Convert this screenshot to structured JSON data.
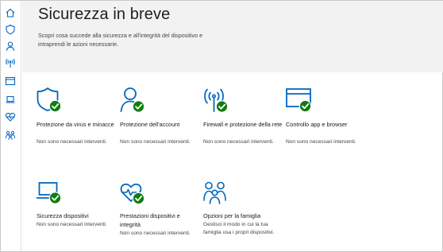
{
  "header": {
    "title": "Sicurezza in breve",
    "description": "Scopri cosa succede alla sicurezza e all'integrità del dispositivo e intraprendi le azioni necessarie."
  },
  "sidebar": {
    "items": [
      {
        "icon": "home-icon"
      },
      {
        "icon": "shield-icon"
      },
      {
        "icon": "person-icon"
      },
      {
        "icon": "wireless-icon"
      },
      {
        "icon": "browser-window-icon"
      },
      {
        "icon": "laptop-icon"
      },
      {
        "icon": "heart-icon"
      },
      {
        "icon": "family-icon"
      }
    ]
  },
  "colors": {
    "accent": "#0067c0",
    "status_ok": "#107c10",
    "header_bg": "#f2f2f2"
  },
  "tiles": [
    {
      "icon": "shield-icon",
      "title": "Protezione da virus e minacce",
      "status": "Non sono necessari interventi."
    },
    {
      "icon": "person-icon",
      "title": "Protezione dell'account",
      "status": "Non sono necessari interventi."
    },
    {
      "icon": "wireless-icon",
      "title": "Firewall e protezione della rete",
      "status": "Non sono necessari interventi."
    },
    {
      "icon": "browser-window-icon",
      "title": "Controllo app e browser",
      "status": "Non sono necessari interventi."
    },
    {
      "icon": "laptop-icon",
      "title": "Sicurezza dispositivi",
      "status": "Non sono necessari interventi."
    },
    {
      "icon": "heart-icon",
      "title": "Prestazioni dispositivi e integrità",
      "status": "Non sono necessari interventi."
    },
    {
      "icon": "family-icon",
      "title": "Opzioni per la famiglia",
      "status": "Gestisci il modo in cui la tua famiglia usa i propri dispositivi."
    }
  ]
}
